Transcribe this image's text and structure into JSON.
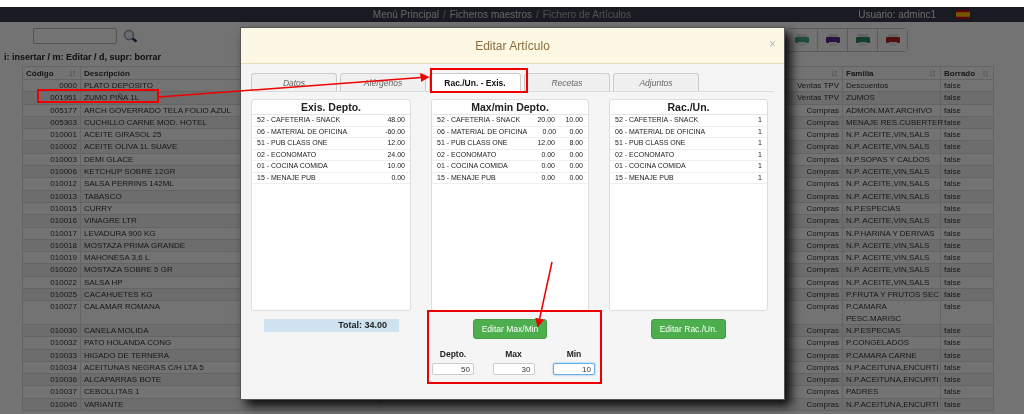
{
  "top_bar": {
    "breadcrumbs": [
      {
        "label": "Menú Principal",
        "selected": false
      },
      {
        "label": "Ficheros maestros",
        "selected": false
      },
      {
        "label": "Fichero de Artículos",
        "selected": true
      }
    ],
    "separator": "/",
    "user": "Usuario: adminc1"
  },
  "shortcuts": "i: insertar / m: Editar / d, supr: borrar",
  "table": {
    "columns": [
      {
        "label": "Código",
        "sortable": true
      },
      {
        "label": "Descripción"
      },
      {
        "sortable": true
      },
      {
        "label": "Familia",
        "sortable": true
      },
      {
        "label": "Borrado",
        "sortable": true
      }
    ],
    "rows": [
      {
        "codigo": "0000",
        "descripcion": "PLATO DEPOSITO",
        "column_3": "Ventas TPV",
        "familia": "Descuentos",
        "borrado": "false"
      },
      {
        "codigo": "001951",
        "descripcion": "ZUMO PIÑA 1L",
        "column_3": "Ventas TPV",
        "familia": "ZUMOS",
        "borrado": "false"
      },
      {
        "codigo": "005177",
        "descripcion": "ARCH GOVERRADO TELA FOLIO AZUL",
        "column_3": "Compras",
        "familia": "ADMON.MAT.ARCHIVO",
        "borrado": "false"
      },
      {
        "codigo": "005303",
        "descripcion": "CUCHILLO CARNE MOD. HOTEL",
        "column_3": "Compras",
        "familia": "MENAJE RES.CUBERTER",
        "borrado": "false"
      },
      {
        "codigo": "010001",
        "descripcion": "ACEITE GIRASOL 25",
        "column_3": "Compras",
        "familia": "N.P. ACEITE,VIN,SALS",
        "borrado": "false"
      },
      {
        "codigo": "010002",
        "descripcion": "ACEITE OLIVA 1L SUAVE",
        "column_3": "Compras",
        "familia": "N.P. ACEITE,VIN,SALS",
        "borrado": "false"
      },
      {
        "codigo": "010003",
        "descripcion": "DEMI GLACE",
        "column_3": "Compras",
        "familia": "N.P.SOPAS Y CALDOS",
        "borrado": "false"
      },
      {
        "codigo": "010006",
        "descripcion": "KETCHUP SOBRE 12GR",
        "column_3": "Compras",
        "familia": "N.P. ACEITE,VIN,SALS",
        "borrado": "false"
      },
      {
        "codigo": "010012",
        "descripcion": "SALSA PERRINS 142ML",
        "column_3": "Compras",
        "familia": "N.P. ACEITE,VIN,SALS",
        "borrado": "false"
      },
      {
        "codigo": "010013",
        "descripcion": "TABASCO",
        "column_3": "Compras",
        "familia": "N.P. ACEITE,VIN,SALS",
        "borrado": "false"
      },
      {
        "codigo": "010015",
        "descripcion": "CURRY",
        "column_3": "Compras",
        "familia": "N.P.ESPECIAS",
        "borrado": "false"
      },
      {
        "codigo": "010016",
        "descripcion": "VINAGRE LTR",
        "column_3": "Compras",
        "familia": "N.P. ACEITE,VIN,SALS",
        "borrado": "false"
      },
      {
        "codigo": "010017",
        "descripcion": "LEVADURA 900 KG",
        "column_3": "Compras",
        "familia": "N.P.HARINA Y DERIVAS",
        "borrado": "false"
      },
      {
        "codigo": "010018",
        "descripcion": "MOSTAZA PRIMA GRANDE",
        "column_3": "Compras",
        "familia": "N.P. ACEITE,VIN,SALS",
        "borrado": "false"
      },
      {
        "codigo": "010019",
        "descripcion": "MAHONESA 3,6 L",
        "column_3": "Compras",
        "familia": "N.P. ACEITE,VIN,SALS",
        "borrado": "false"
      },
      {
        "codigo": "010020",
        "descripcion": "MOSTAZA SOBRE 5 GR",
        "column_3": "Compras",
        "familia": "N.P. ACEITE,VIN,SALS",
        "borrado": "false"
      },
      {
        "codigo": "010022",
        "descripcion": "SALSA HP",
        "column_3": "Compras",
        "familia": "N.P. ACEITE,VIN,SALS",
        "borrado": "false"
      },
      {
        "codigo": "010025",
        "descripcion": "CACAHUETES KG",
        "column_3": "Compras",
        "familia": "P.FRUTA Y FRUTOS SEC",
        "borrado": "false"
      },
      {
        "codigo": "010027",
        "descripcion": "CALAMAR ROMANA",
        "column_3": "Compras",
        "familia": "P.CAMARA\nPESC.MARISC",
        "borrado": "false"
      },
      {
        "codigo": "010030",
        "descripcion": "CANELA MOLIDA",
        "column_3": "Compras",
        "familia": "N.P.ESPECIAS",
        "borrado": "false"
      },
      {
        "codigo": "010032",
        "descripcion": "PATO HOLANDA CONG",
        "column_3": "Compras",
        "familia": "P.CONGELADOS",
        "borrado": "false"
      },
      {
        "codigo": "010033",
        "descripcion": "HIGADO DE TERNERA",
        "column_3": "Compras",
        "familia": "P.CAMARA CARNE",
        "borrado": "false"
      },
      {
        "codigo": "010034",
        "descripcion": "ACEITUNAS NEGRAS C/H LTA 5",
        "column_3": "Compras",
        "familia": "N.P.ACEITUNA,ENCURTI",
        "borrado": "false"
      },
      {
        "codigo": "010036",
        "descripcion": "ALCAPARRAS BOTE",
        "column_3": "Compras",
        "familia": "N.P.ACEITUNA,ENCURTI",
        "borrado": "false"
      },
      {
        "codigo": "010037",
        "descripcion": "CEBOLLITAS 1",
        "column_3": "Compras",
        "familia": "PADRES",
        "borrado": "false"
      },
      {
        "codigo": "010040",
        "descripcion": "VARIANTE",
        "column_3": "Compras",
        "familia": "N.P.ACEITUNA,ENCURTI",
        "borrado": "false"
      }
    ]
  },
  "modal": {
    "title": "Editar Artículo",
    "close": "×",
    "tabs": [
      {
        "label": "Datos",
        "selected": false
      },
      {
        "label": "Alérgenos",
        "selected": false
      },
      {
        "label": "Rac./Un. - Exis.",
        "selected": true
      },
      {
        "label": "Recetas",
        "selected": false
      },
      {
        "label": "Adjuntos",
        "selected": false
      }
    ],
    "stock_panel": {
      "title": "Exis. Depto.",
      "rows": [
        {
          "name": "52 - CAFETERIA - SNACK",
          "value": "48.00"
        },
        {
          "name": "06 - MATERIAL DE OFICINA",
          "value": "-60.00"
        },
        {
          "name": "51 - PUB CLASS ONE",
          "value": "12.00"
        },
        {
          "name": "02 - ECONOMATO",
          "value": "24.00"
        },
        {
          "name": "01 - COCINA COMIDA",
          "value": "10.00"
        },
        {
          "name": "15 - MENAJE PUB",
          "value": "0.00"
        }
      ],
      "total": "Total: 34.00"
    },
    "maxmin_panel": {
      "title": "Max/min Depto.",
      "rows": [
        {
          "name": "52 - CAFETERIA - SNACK",
          "max": "20.00",
          "min": "10.00"
        },
        {
          "name": "06 - MATERIAL DE OFICINA",
          "max": "0.00",
          "min": "0.00"
        },
        {
          "name": "51 - PUB CLASS ONE",
          "max": "12.00",
          "min": "8.00"
        },
        {
          "name": "02 - ECONOMATO",
          "max": "0.00",
          "min": "0.00"
        },
        {
          "name": "01 - COCINA COMIDA",
          "max": "0.00",
          "min": "0.00"
        },
        {
          "name": "15 - MENAJE PUB",
          "max": "0.00",
          "min": "0.00"
        }
      ],
      "button": "Editar Max/Min",
      "fields": [
        {
          "label": "Depto.",
          "value": "50",
          "focused": false
        },
        {
          "label": "Max",
          "value": "30",
          "focused": false
        },
        {
          "label": "Min",
          "value": "10",
          "focused": true
        }
      ]
    },
    "ration_panel": {
      "title": "Rac./Un.",
      "rows": [
        {
          "name": "52 - CAFETERIA - SNACK",
          "value": "1"
        },
        {
          "name": "06 - MATERIAL DE OFICINA",
          "value": "1"
        },
        {
          "name": "51 - PUB CLASS ONE",
          "value": "1"
        },
        {
          "name": "02 - ECONOMATO",
          "value": "1"
        },
        {
          "name": "01 - COCINA COMIDA",
          "value": "1"
        },
        {
          "name": "15 - MENAJE PUB",
          "value": "1"
        }
      ],
      "button": "Editar Rac./Un."
    }
  }
}
